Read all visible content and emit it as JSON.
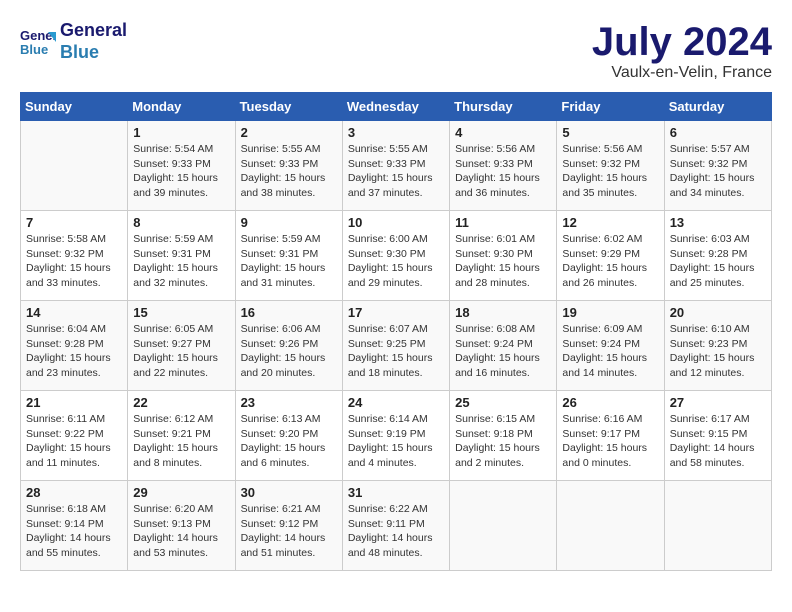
{
  "header": {
    "logo_line1": "General",
    "logo_line2": "Blue",
    "title": "July 2024",
    "location": "Vaulx-en-Velin, France"
  },
  "columns": [
    "Sunday",
    "Monday",
    "Tuesday",
    "Wednesday",
    "Thursday",
    "Friday",
    "Saturday"
  ],
  "weeks": [
    [
      {
        "day": "",
        "info": ""
      },
      {
        "day": "1",
        "info": "Sunrise: 5:54 AM\nSunset: 9:33 PM\nDaylight: 15 hours\nand 39 minutes."
      },
      {
        "day": "2",
        "info": "Sunrise: 5:55 AM\nSunset: 9:33 PM\nDaylight: 15 hours\nand 38 minutes."
      },
      {
        "day": "3",
        "info": "Sunrise: 5:55 AM\nSunset: 9:33 PM\nDaylight: 15 hours\nand 37 minutes."
      },
      {
        "day": "4",
        "info": "Sunrise: 5:56 AM\nSunset: 9:33 PM\nDaylight: 15 hours\nand 36 minutes."
      },
      {
        "day": "5",
        "info": "Sunrise: 5:56 AM\nSunset: 9:32 PM\nDaylight: 15 hours\nand 35 minutes."
      },
      {
        "day": "6",
        "info": "Sunrise: 5:57 AM\nSunset: 9:32 PM\nDaylight: 15 hours\nand 34 minutes."
      }
    ],
    [
      {
        "day": "7",
        "info": "Sunrise: 5:58 AM\nSunset: 9:32 PM\nDaylight: 15 hours\nand 33 minutes."
      },
      {
        "day": "8",
        "info": "Sunrise: 5:59 AM\nSunset: 9:31 PM\nDaylight: 15 hours\nand 32 minutes."
      },
      {
        "day": "9",
        "info": "Sunrise: 5:59 AM\nSunset: 9:31 PM\nDaylight: 15 hours\nand 31 minutes."
      },
      {
        "day": "10",
        "info": "Sunrise: 6:00 AM\nSunset: 9:30 PM\nDaylight: 15 hours\nand 29 minutes."
      },
      {
        "day": "11",
        "info": "Sunrise: 6:01 AM\nSunset: 9:30 PM\nDaylight: 15 hours\nand 28 minutes."
      },
      {
        "day": "12",
        "info": "Sunrise: 6:02 AM\nSunset: 9:29 PM\nDaylight: 15 hours\nand 26 minutes."
      },
      {
        "day": "13",
        "info": "Sunrise: 6:03 AM\nSunset: 9:28 PM\nDaylight: 15 hours\nand 25 minutes."
      }
    ],
    [
      {
        "day": "14",
        "info": "Sunrise: 6:04 AM\nSunset: 9:28 PM\nDaylight: 15 hours\nand 23 minutes."
      },
      {
        "day": "15",
        "info": "Sunrise: 6:05 AM\nSunset: 9:27 PM\nDaylight: 15 hours\nand 22 minutes."
      },
      {
        "day": "16",
        "info": "Sunrise: 6:06 AM\nSunset: 9:26 PM\nDaylight: 15 hours\nand 20 minutes."
      },
      {
        "day": "17",
        "info": "Sunrise: 6:07 AM\nSunset: 9:25 PM\nDaylight: 15 hours\nand 18 minutes."
      },
      {
        "day": "18",
        "info": "Sunrise: 6:08 AM\nSunset: 9:24 PM\nDaylight: 15 hours\nand 16 minutes."
      },
      {
        "day": "19",
        "info": "Sunrise: 6:09 AM\nSunset: 9:24 PM\nDaylight: 15 hours\nand 14 minutes."
      },
      {
        "day": "20",
        "info": "Sunrise: 6:10 AM\nSunset: 9:23 PM\nDaylight: 15 hours\nand 12 minutes."
      }
    ],
    [
      {
        "day": "21",
        "info": "Sunrise: 6:11 AM\nSunset: 9:22 PM\nDaylight: 15 hours\nand 11 minutes."
      },
      {
        "day": "22",
        "info": "Sunrise: 6:12 AM\nSunset: 9:21 PM\nDaylight: 15 hours\nand 8 minutes."
      },
      {
        "day": "23",
        "info": "Sunrise: 6:13 AM\nSunset: 9:20 PM\nDaylight: 15 hours\nand 6 minutes."
      },
      {
        "day": "24",
        "info": "Sunrise: 6:14 AM\nSunset: 9:19 PM\nDaylight: 15 hours\nand 4 minutes."
      },
      {
        "day": "25",
        "info": "Sunrise: 6:15 AM\nSunset: 9:18 PM\nDaylight: 15 hours\nand 2 minutes."
      },
      {
        "day": "26",
        "info": "Sunrise: 6:16 AM\nSunset: 9:17 PM\nDaylight: 15 hours\nand 0 minutes."
      },
      {
        "day": "27",
        "info": "Sunrise: 6:17 AM\nSunset: 9:15 PM\nDaylight: 14 hours\nand 58 minutes."
      }
    ],
    [
      {
        "day": "28",
        "info": "Sunrise: 6:18 AM\nSunset: 9:14 PM\nDaylight: 14 hours\nand 55 minutes."
      },
      {
        "day": "29",
        "info": "Sunrise: 6:20 AM\nSunset: 9:13 PM\nDaylight: 14 hours\nand 53 minutes."
      },
      {
        "day": "30",
        "info": "Sunrise: 6:21 AM\nSunset: 9:12 PM\nDaylight: 14 hours\nand 51 minutes."
      },
      {
        "day": "31",
        "info": "Sunrise: 6:22 AM\nSunset: 9:11 PM\nDaylight: 14 hours\nand 48 minutes."
      },
      {
        "day": "",
        "info": ""
      },
      {
        "day": "",
        "info": ""
      },
      {
        "day": "",
        "info": ""
      }
    ]
  ]
}
